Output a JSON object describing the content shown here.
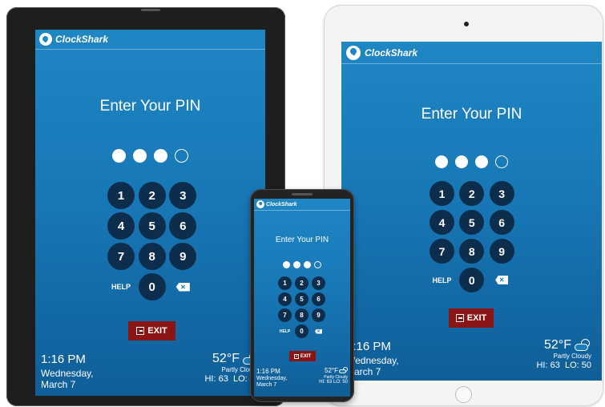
{
  "app": {
    "brand": "ClockShark"
  },
  "screen": {
    "title": "Enter Your PIN",
    "pin_dots": [
      true,
      true,
      true,
      false
    ],
    "keys": [
      "1",
      "2",
      "3",
      "4",
      "5",
      "6",
      "7",
      "8",
      "9"
    ],
    "zero_key": "0",
    "help_label": "HELP",
    "exit_label": "EXIT"
  },
  "footer": {
    "time": "1:16 PM",
    "day": "Wednesday,",
    "date": "March 7",
    "temperature": "52°F",
    "condition": "Partly Cloudy",
    "hi": "HI: 63",
    "lo": "LO: 50"
  },
  "icons": [
    "clockshark-logo-icon",
    "backspace-icon",
    "exit-icon",
    "partly-cloudy-icon"
  ],
  "colors": {
    "screen_blue": "#1878b6",
    "key_navy": "#0d2d4d",
    "exit_red": "#8b1414"
  }
}
